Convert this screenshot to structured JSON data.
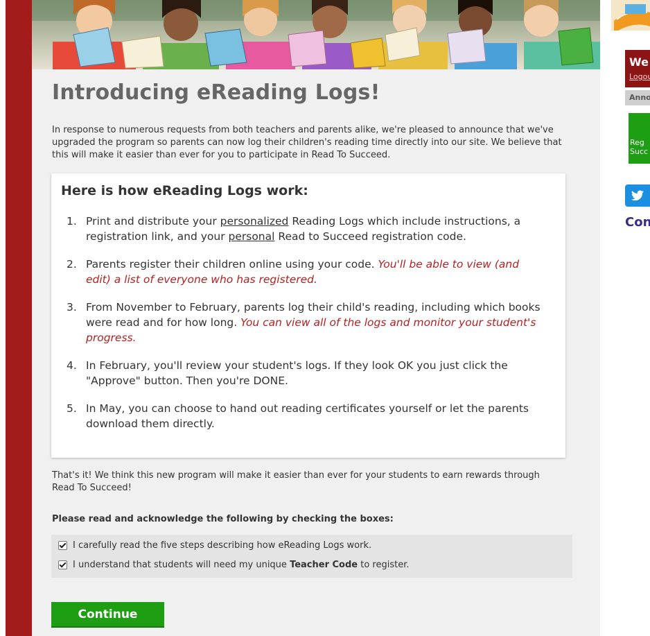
{
  "intro": {
    "title": "Introducing eReading Logs!",
    "paragraph": "In response to numerous requests from both teachers and parents alike, we're pleased to announce that we've upgraded the program so parents can now log their children's reading time directly into our site. We believe that this will make it easier than ever for you to participate in Read To Succeed."
  },
  "steps_card": {
    "title": "Here is how eReading Logs work:",
    "steps": [
      {
        "num": "1.",
        "t1": "Print and distribute your ",
        "u1": "personalized",
        "t2": " Reading Logs which include instructions, a registration link, and your ",
        "u2": "personal",
        "t3": " Read to Succeed registration code."
      },
      {
        "num": "2.",
        "text": "Parents register their children online using your code. ",
        "note": "You'll be able to view (and edit) a list of everyone who has registered."
      },
      {
        "num": "3.",
        "text": "From November to February, parents log their child's reading, including which books were read and for how long. ",
        "note": "You can view all of the logs and monitor your student's progress."
      },
      {
        "num": "4.",
        "text": "In February, you'll review your student's logs. If they look OK you just click the \"Approve\" button. Then you're DONE."
      },
      {
        "num": "5.",
        "text": "In May, you can choose to hand out reading certificates yourself or let the parents download them directly."
      }
    ]
  },
  "closing": "That's it! We think this new program will make it easier than ever for your students to earn rewards through Read To Succeed!",
  "acknowledge": {
    "heading": "Please read and acknowledge the following by checking the boxes:",
    "item1": "I carefully read the five steps describing how eReading Logs work.",
    "item2_before": "I understand that students will need my unique ",
    "item2_bold": "Teacher Code",
    "item2_after": " to register.",
    "item1_checked": true,
    "item2_checked": true
  },
  "continue_label": "Continue",
  "sidebar": {
    "welcome": "We",
    "logout": "Logou",
    "announcements": "Anno",
    "green_line1": "Reg",
    "green_line2": "Succ",
    "con_heading": "Con"
  },
  "colors": {
    "left_bar": "#a31b1b",
    "continue_button": "#1e9e12",
    "note_red": "#b22222",
    "twitter": "#1d8fe1",
    "heading_purple": "#3c2a8a"
  },
  "icons": [
    "twitter-icon",
    "checkbox-checked-icon"
  ]
}
